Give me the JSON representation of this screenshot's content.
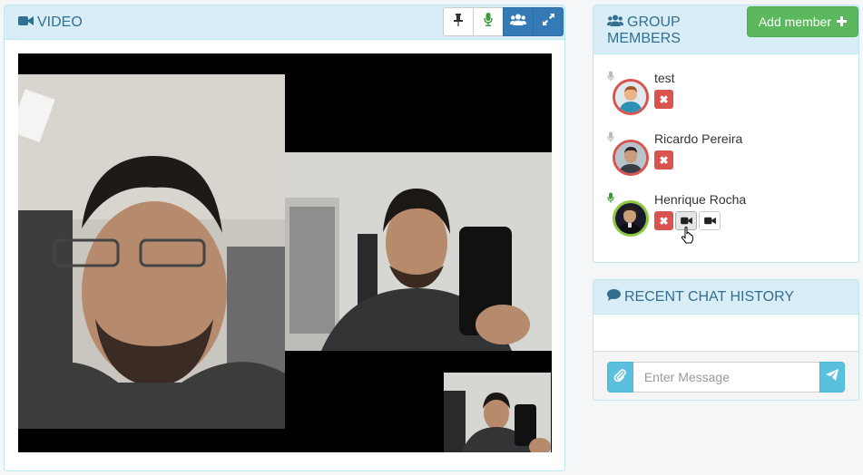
{
  "video_panel": {
    "title": "VIDEO",
    "toolbar": {
      "icons": [
        "pin-icon",
        "microphone-icon",
        "users-icon",
        "expand-icon"
      ]
    }
  },
  "members_panel": {
    "title": "GROUP MEMBERS",
    "add_button_label": "Add member",
    "members": [
      {
        "name": "test",
        "mic": "muted",
        "avatar_border": "red",
        "controls": [
          "remove"
        ]
      },
      {
        "name": "Ricardo Pereira",
        "mic": "muted",
        "avatar_border": "red",
        "controls": [
          "remove"
        ]
      },
      {
        "name": "Henrique Rocha",
        "mic": "active",
        "avatar_border": "green",
        "controls": [
          "remove",
          "camera",
          "camera"
        ]
      }
    ]
  },
  "chat_panel": {
    "title": "RECENT CHAT HISTORY",
    "message_placeholder": "Enter Message"
  },
  "colors": {
    "heading_bg": "#d9edf7",
    "heading_text": "#31708f",
    "primary": "#337ab7",
    "success": "#5cb85c",
    "danger": "#d9534f",
    "info": "#5bc0de",
    "mic_active": "#5cb85c"
  }
}
